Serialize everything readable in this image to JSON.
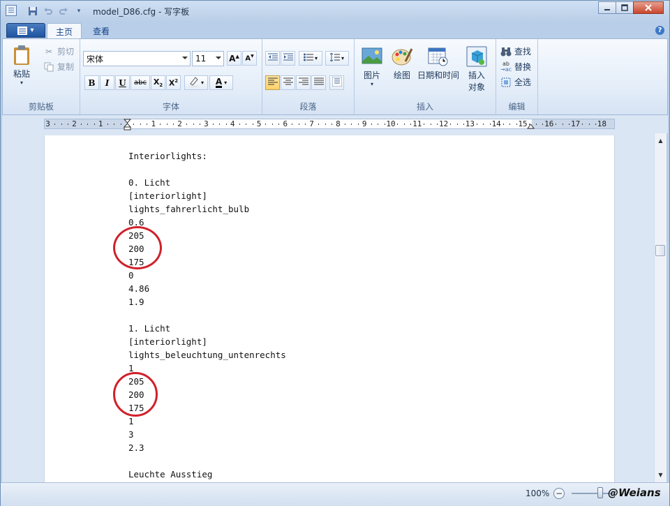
{
  "window": {
    "title": "model_D86.cfg - 写字板",
    "tabs": [
      "主页",
      "查看"
    ],
    "active_tab": "主页"
  },
  "ribbon": {
    "clipboard": {
      "group_label": "剪贴板",
      "paste": "粘贴",
      "cut": "剪切",
      "copy": "复制"
    },
    "font": {
      "group_label": "字体",
      "font_name": "宋体",
      "font_size": "11"
    },
    "paragraph": {
      "group_label": "段落"
    },
    "insert": {
      "group_label": "插入",
      "picture": "图片",
      "paint": "绘图",
      "datetime": "日期和时间",
      "object_line1": "插入",
      "object_line2": "对象"
    },
    "editing": {
      "group_label": "编辑",
      "find": "查找",
      "replace": "替换",
      "select_all": "全选"
    }
  },
  "ruler": {
    "numbers": [
      "3",
      "2",
      "1",
      "1",
      "2",
      "3",
      "4",
      "5",
      "6",
      "7",
      "8",
      "9",
      "10",
      "11",
      "12",
      "13",
      "14",
      "15",
      "16",
      "17",
      "18"
    ]
  },
  "document": {
    "lines": [
      "Interiorlights:",
      "",
      "0. Licht",
      "[interiorlight]",
      "lights_fahrerlicht_bulb",
      "0.6",
      "205",
      "200",
      "175",
      "0",
      "4.86",
      "1.9",
      "",
      "1. Licht",
      "[interiorlight]",
      "lights_beleuchtung_untenrechts",
      "1",
      "205",
      "200",
      "175",
      "1",
      "3",
      "2.3",
      "",
      "Leuchte Ausstieg"
    ]
  },
  "statusbar": {
    "zoom": "100%",
    "watermark": "@Weians"
  },
  "colors": {
    "annotation_circle": "#d0202a",
    "menu_button": "#1f54a0"
  }
}
